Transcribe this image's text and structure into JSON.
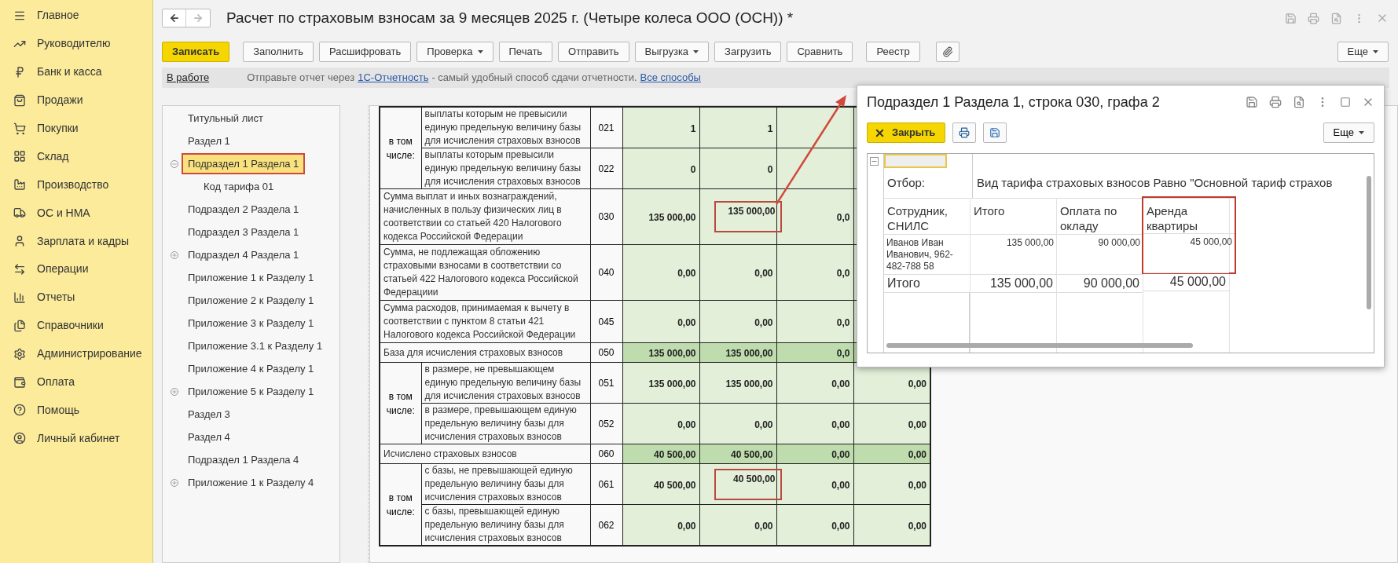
{
  "sidebar": {
    "items": [
      {
        "label": "Главное"
      },
      {
        "label": "Руководителю"
      },
      {
        "label": "Банк и касса"
      },
      {
        "label": "Продажи"
      },
      {
        "label": "Покупки"
      },
      {
        "label": "Склад"
      },
      {
        "label": "Производство"
      },
      {
        "label": "ОС и НМА"
      },
      {
        "label": "Зарплата и кадры"
      },
      {
        "label": "Операции"
      },
      {
        "label": "Отчеты"
      },
      {
        "label": "Справочники"
      },
      {
        "label": "Администрирование"
      },
      {
        "label": "Оплата"
      },
      {
        "label": "Помощь"
      },
      {
        "label": "Личный кабинет"
      }
    ]
  },
  "document": {
    "title": "Расчет по страховым взносам за 9 месяцев 2025 г. (Четыре колеса ООО (ОСН)) *"
  },
  "toolbar": {
    "buttons": [
      {
        "label": "Записать",
        "kind": "primary"
      },
      {
        "label": "Заполнить",
        "kind": "plain"
      },
      {
        "label": "Расшифровать",
        "kind": "plain"
      },
      {
        "label": "Проверка",
        "kind": "dropdown"
      },
      {
        "label": "Печать",
        "kind": "plain"
      },
      {
        "label": "Отправить",
        "kind": "plain"
      },
      {
        "label": "Выгрузка",
        "kind": "dropdown"
      },
      {
        "label": "Загрузить",
        "kind": "plain"
      },
      {
        "label": "Сравнить",
        "kind": "plain"
      },
      {
        "label": "Реестр",
        "kind": "separated"
      }
    ],
    "more": "Еще"
  },
  "info_bar": {
    "status": "В работе",
    "text_before": "Отправьте отчет через",
    "link": "1С-Отчетность",
    "text_after": "- самый удобный способ сдачи отчетности.",
    "link2": "Все способы"
  },
  "tree": {
    "items": [
      {
        "label": "Титульный лист",
        "selected": false
      },
      {
        "label": "Раздел 1",
        "selected": false
      },
      {
        "label": "Подраздел 1 Раздела 1",
        "selected": true,
        "annotated": true,
        "expanded": true,
        "children": [
          {
            "label": "Код тарифа 01",
            "selected": false
          }
        ]
      },
      {
        "label": "Подраздел 2 Раздела 1",
        "selected": false
      },
      {
        "label": "Подраздел 3 Раздела 1",
        "selected": false
      },
      {
        "label": "Подраздел 4 Раздела 1",
        "selected": false,
        "expanded": false
      },
      {
        "label": "Приложение 1 к Разделу 1",
        "selected": false
      },
      {
        "label": "Приложение 2 к Разделу 1",
        "selected": false
      },
      {
        "label": "Приложение 3 к Разделу 1",
        "selected": false
      },
      {
        "label": "Приложение 3.1 к Разделу 1",
        "selected": false
      },
      {
        "label": "Приложение 4 к Разделу 1",
        "selected": false
      },
      {
        "label": "Приложение 5 к Разделу 1",
        "selected": false,
        "expanded": false
      },
      {
        "label": "Раздел 3",
        "selected": false
      },
      {
        "label": "Раздел 4",
        "selected": false
      },
      {
        "label": "Подраздел 1 Раздела 4",
        "selected": false
      },
      {
        "label": "Приложение 1 к Разделу 4",
        "selected": false,
        "expanded": false
      }
    ]
  },
  "table": {
    "rows": [
      {
        "kind": "group",
        "label": "в том числе:",
        "rows": [
          {
            "text": "выплаты которым не превысили единую предельную величину базы для исчисления страховых взносов",
            "code": "021",
            "values": [
              {
                "v": "1",
                "annotated": false
              },
              {
                "v": "1",
                "annotated": false
              }
            ]
          },
          {
            "text": "выплаты которым превысили единую предельную величину базы для исчисления страховых взносов",
            "code": "022",
            "values": [
              {
                "v": "0",
                "annotated": false
              },
              {
                "v": "0",
                "annotated": false
              }
            ]
          }
        ]
      },
      {
        "kind": "line",
        "text": "Сумма выплат и иных вознаграждений, начисленных в пользу физических лиц в соответствии со статьей 420 Налогового кодекса Российской Федерации",
        "code": "030",
        "values": [
          {
            "v": "135 000,00",
            "annotated": false
          },
          {
            "v": "135 000,00",
            "annotated": true
          },
          {
            "v": "0,0",
            "annotated": false
          }
        ]
      },
      {
        "kind": "line",
        "text": "Сумма, не подлежащая обложению страховыми взносами в соответствии со статьей 422 Налогового кодекса Российской  Федерациии",
        "code": "040",
        "values": [
          {
            "v": "0,00",
            "annotated": false
          },
          {
            "v": "0,00",
            "annotated": false
          },
          {
            "v": "0,0",
            "annotated": false
          }
        ]
      },
      {
        "kind": "line",
        "text": "Сумма расходов, принимаемая к вычету в соответствии с пунктом 8 статьи 421 Налогового кодекса Российской Федерации",
        "code": "045",
        "values": [
          {
            "v": "0,00",
            "annotated": false
          },
          {
            "v": "0,00",
            "annotated": false
          },
          {
            "v": "0,0",
            "annotated": false
          }
        ]
      },
      {
        "kind": "total",
        "text": "База для исчисления страховых взносов",
        "code": "050",
        "values": [
          {
            "v": "135 000,00",
            "annotated": false
          },
          {
            "v": "135 000,00",
            "annotated": false
          },
          {
            "v": "0,0",
            "annotated": false
          }
        ]
      },
      {
        "kind": "group",
        "label": "в том числе:",
        "rows": [
          {
            "text": "в размере, не превышающем единую предельную величину базы для исчисления страховых взносов",
            "code": "051",
            "values": [
              {
                "v": "135 000,00",
                "annotated": false
              },
              {
                "v": "135 000,00",
                "annotated": false
              },
              {
                "v": "0,00",
                "annotated": false
              },
              {
                "v": "0,00",
                "annotated": false
              }
            ]
          },
          {
            "text": "в размере, превышающем единую предельную величину базы для исчисления страховых взносов",
            "code": "052",
            "values": [
              {
                "v": "0,00",
                "annotated": false
              },
              {
                "v": "0,00",
                "annotated": false
              },
              {
                "v": "0,00",
                "annotated": false
              },
              {
                "v": "0,00",
                "annotated": false
              }
            ]
          }
        ]
      },
      {
        "kind": "total",
        "text": "Исчислено страховых взносов",
        "code": "060",
        "values": [
          {
            "v": "40 500,00",
            "annotated": false
          },
          {
            "v": "40 500,00",
            "annotated": false
          },
          {
            "v": "0,00",
            "annotated": false
          },
          {
            "v": "0,00",
            "annotated": false
          }
        ]
      },
      {
        "kind": "group",
        "label": "в том числе:",
        "rows": [
          {
            "text": "с базы, не превышающей единую предельную величину базы для исчисления страховых взносов",
            "code": "061",
            "values": [
              {
                "v": "40 500,00",
                "annotated": false
              },
              {
                "v": "40 500,00",
                "annotated": true
              },
              {
                "v": "0,00",
                "annotated": false
              },
              {
                "v": "0,00",
                "annotated": false
              }
            ]
          },
          {
            "text": "с базы, превышающей единую предельную величину базы для исчисления страховых взносов",
            "code": "062",
            "values": [
              {
                "v": "0,00",
                "annotated": false
              },
              {
                "v": "0,00",
                "annotated": false
              },
              {
                "v": "0,00",
                "annotated": false
              },
              {
                "v": "0,00",
                "annotated": false
              }
            ]
          }
        ]
      }
    ]
  },
  "popup": {
    "title": "Подраздел 1 Раздела 1, строка 030, графа 2",
    "close_button": "Закрыть",
    "more": "Еще",
    "report": {
      "filter_label": "Отбор:",
      "filter_text": "Вид тарифа страховых взносов Равно \"Основной тариф страхов",
      "columns": [
        {
          "label": "Сотрудник, СНИЛС",
          "annotated": false,
          "cells": [
            "Иванов Иван Иванович, 962-482-788 58"
          ],
          "total": "Итого"
        },
        {
          "label": "Итого",
          "annotated": false,
          "cells": [
            "135 000,00"
          ],
          "total": "135 000,00"
        },
        {
          "label": "Оплата по окладу",
          "annotated": false,
          "cells": [
            "90 000,00"
          ],
          "total": "90 000,00"
        },
        {
          "label": "Аренда квартиры",
          "annotated": true,
          "cells": [
            "45 000,00"
          ],
          "total": "45 000,00"
        }
      ]
    }
  }
}
